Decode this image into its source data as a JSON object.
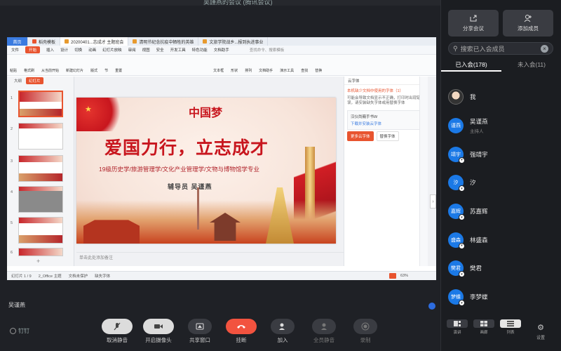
{
  "window": {
    "title": "吴謹燕的会议 (腾讯会议)"
  },
  "wps": {
    "tabs": [
      {
        "label": "首页"
      },
      {
        "label": "稻壳模板"
      },
      {
        "label": "20200401...志成才 主题班会"
      },
      {
        "label": "清明节纪念抗疫中牺牲的英雄"
      },
      {
        "label": "文旅学院战乡...报到执进事业"
      }
    ],
    "menu": [
      "文件",
      "开始",
      "插入",
      "设计",
      "切换",
      "动画",
      "幻灯片放映",
      "审阅",
      "视图",
      "安全",
      "开发工具",
      "特色功能",
      "文档助手"
    ],
    "menu_search": "查找命令、搜索模板",
    "ribbon": [
      "粘贴",
      "格式刷",
      "从当前开始",
      "新建幻灯片",
      "版式",
      "节",
      "重置",
      "文本框",
      "形状",
      "排列",
      "文档助手",
      "演示工具",
      "查找",
      "替换"
    ],
    "thumb_tabs": {
      "outline": "大纲",
      "slides": "幻灯片"
    },
    "thumbs": [
      "1",
      "2",
      "3",
      "4",
      "5",
      "6"
    ],
    "slide": {
      "dream": "中国梦",
      "title": "爱国力行，立志成才",
      "subtitle": "19级历史学/旅游管理学/文化产业管理学/文物与博物馆学专业",
      "tutor": "辅导员  吴谨燕"
    },
    "notes_placeholder": "单击此处添加备注",
    "right_panel": {
      "header": "云字体",
      "warning": "本机缺少文档中使用的字体（1）",
      "desc": "可能会导致文档显示不正确，打印时出现错误，请安装缺失字体或用替换字体",
      "font_name": "汉仪尚巍手书W",
      "download": "下载并安装云字体",
      "btn_more": "更多云字体",
      "btn_replace": "替换字体"
    },
    "status": {
      "slide_count": "幻灯片 1 / 9",
      "theme": "2_Office 主题",
      "protect": "文档未保护",
      "missing": "缺失字体",
      "zoom": "63%"
    }
  },
  "speaker_label": "吴谨燕",
  "controls": {
    "pin": "钉钉",
    "buttons": [
      {
        "label": "取消静音",
        "icon": "mic-off-icon",
        "style": "light"
      },
      {
        "label": "开启摄像头",
        "icon": "camera-icon",
        "style": "light"
      },
      {
        "label": "共享窗口",
        "icon": "share-window-icon",
        "style": "dark"
      },
      {
        "label": "挂断",
        "icon": "hangup-icon",
        "style": "red"
      },
      {
        "label": "加入",
        "icon": "join-icon",
        "style": "dark"
      },
      {
        "label": "全员静音",
        "icon": "mute-all-icon",
        "style": "dark"
      },
      {
        "label": "录制",
        "icon": "record-icon",
        "style": "dark"
      }
    ]
  },
  "panel": {
    "share_label": "分享会议",
    "add_label": "添加成员",
    "search_placeholder": "搜索已入会成员",
    "tab_joined": "已入会(178)",
    "tab_not_joined": "未入会(11)",
    "participants": [
      {
        "avatar": "",
        "name": "我",
        "role": ""
      },
      {
        "avatar": "谨燕",
        "name": "吴谨燕",
        "role": "主持人"
      },
      {
        "avatar": "靖宇",
        "name": "强靖宇",
        "role": ""
      },
      {
        "avatar": "汐",
        "name": "汐",
        "role": ""
      },
      {
        "avatar": "嘉辉",
        "name": "苏嘉辉",
        "role": ""
      },
      {
        "avatar": "盛森",
        "name": "林盛森",
        "role": ""
      },
      {
        "avatar": "樊君",
        "name": "樊君",
        "role": ""
      },
      {
        "avatar": "梦蝶",
        "name": "李梦蝶",
        "role": ""
      }
    ],
    "views": [
      "演讲",
      "画廊",
      "列表"
    ],
    "settings_label": "设置"
  }
}
